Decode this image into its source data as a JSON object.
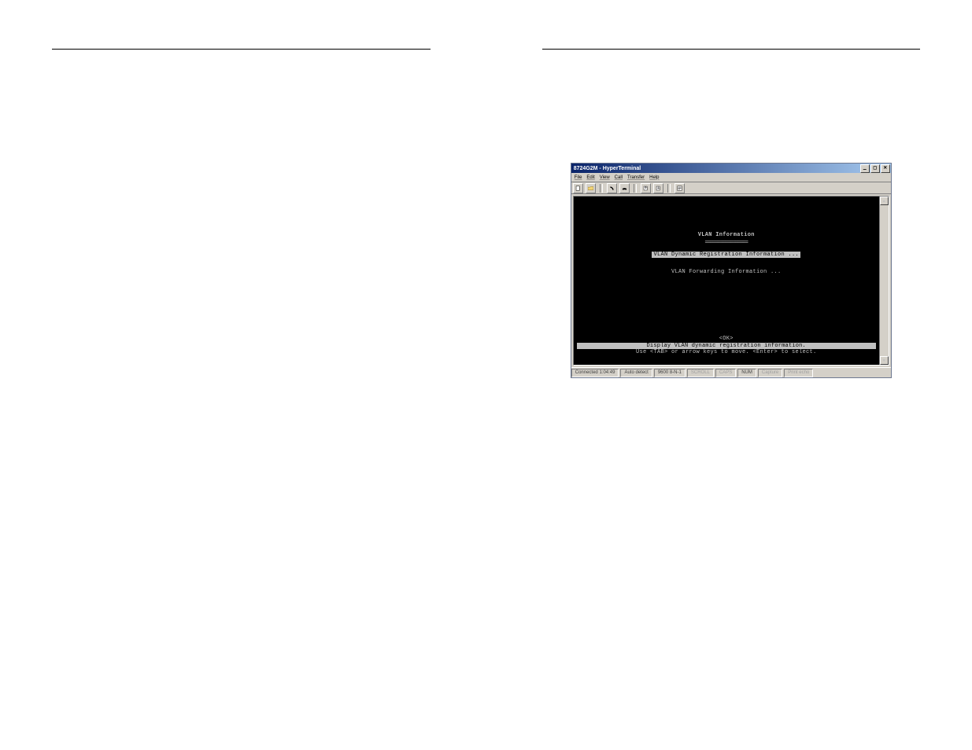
{
  "window": {
    "title": "8724G2M - HyperTerminal",
    "menus": [
      "File",
      "Edit",
      "View",
      "Call",
      "Transfer",
      "Help"
    ],
    "toolbar_icons": [
      "new-doc-icon",
      "open-folder-icon",
      "call-icon",
      "hangup-icon",
      "send-icon",
      "receive-icon",
      "properties-icon"
    ]
  },
  "terminal": {
    "heading": "VLAN Information",
    "heading_rule": "=================",
    "selected_item": "VLAN Dynamic Registration Information ...",
    "item2": "VLAN Forwarding Information ...",
    "ok_label": "<OK>",
    "hint1": "Display VLAN dynamic registration information.",
    "hint2": "Use <TAB> or arrow keys to move. <Enter> to select."
  },
  "status": {
    "conn": "Connected 1:04:49",
    "auto": "Auto detect",
    "baud": "9600 8-N-1",
    "cells_dim": [
      "SCROLL",
      "CAPS",
      "NUM",
      "Capture",
      "Print echo"
    ]
  }
}
